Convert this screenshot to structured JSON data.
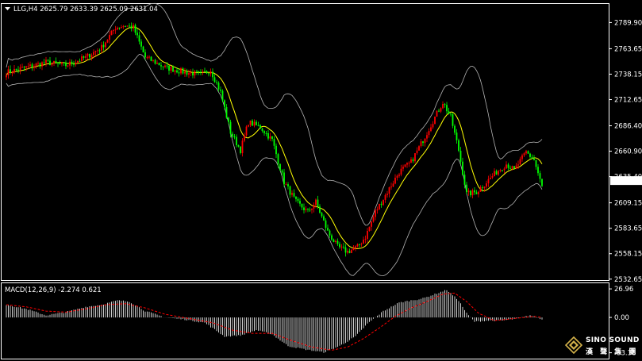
{
  "header": {
    "symbol_line": "LLG,H4  2625.79 2633.39 2625.09 2631.04",
    "macd_line": "MACD(12,26,9) -2.274 0.621"
  },
  "price_axis": {
    "ticks": [
      "2789.90",
      "2763.65",
      "2738.15",
      "2712.65",
      "2686.40",
      "2660.90",
      "2635.40",
      "2609.15",
      "2583.65",
      "2558.15",
      "2532.65"
    ],
    "current": "2631.04"
  },
  "macd_axis": {
    "ticks": [
      "26.96",
      "0.00",
      "-33.38"
    ]
  },
  "logo": {
    "line1": "SINO SOUND",
    "line2": "漢 聲 集 團"
  },
  "colors": {
    "background": "#000000",
    "bull": "#ff0000",
    "bear": "#00ff00",
    "ma": "#ffff00",
    "bands": "#b4b4b4",
    "macd_hist": "#ffffff",
    "signal": "#ff0000",
    "axis": "#ffffff"
  },
  "chart_data": [
    {
      "type": "candlestick",
      "symbol": "LLG",
      "timeframe": "H4",
      "ylim": [
        2532.65,
        2795
      ],
      "ohlc_anchor": [
        [
          0,
          2740
        ],
        [
          10,
          2745
        ],
        [
          20,
          2750
        ],
        [
          30,
          2747
        ],
        [
          40,
          2755
        ],
        [
          48,
          2765
        ],
        [
          55,
          2785
        ],
        [
          60,
          2787
        ],
        [
          64,
          2785
        ],
        [
          70,
          2755
        ],
        [
          80,
          2745
        ],
        [
          90,
          2740
        ],
        [
          98,
          2738
        ],
        [
          103,
          2742
        ],
        [
          108,
          2720
        ],
        [
          113,
          2680
        ],
        [
          118,
          2662
        ],
        [
          122,
          2690
        ],
        [
          128,
          2685
        ],
        [
          134,
          2672
        ],
        [
          140,
          2630
        ],
        [
          146,
          2610
        ],
        [
          152,
          2600
        ],
        [
          156,
          2610
        ],
        [
          162,
          2580
        ],
        [
          167,
          2565
        ],
        [
          172,
          2560
        ],
        [
          177,
          2565
        ],
        [
          181,
          2575
        ],
        [
          186,
          2600
        ],
        [
          192,
          2620
        ],
        [
          198,
          2640
        ],
        [
          204,
          2650
        ],
        [
          210,
          2672
        ],
        [
          216,
          2695
        ],
        [
          220,
          2710
        ],
        [
          224,
          2695
        ],
        [
          228,
          2662
        ],
        [
          232,
          2618
        ],
        [
          237,
          2620
        ],
        [
          241,
          2628
        ],
        [
          247,
          2640
        ],
        [
          252,
          2648
        ],
        [
          256,
          2642
        ],
        [
          262,
          2660
        ],
        [
          266,
          2652
        ],
        [
          270,
          2625
        ]
      ]
    },
    {
      "type": "macd",
      "params": "12,26,9",
      "ylim": [
        -33.38,
        26.96
      ],
      "hist_anchor": [
        [
          0,
          12
        ],
        [
          10,
          8
        ],
        [
          20,
          2
        ],
        [
          30,
          5
        ],
        [
          40,
          10
        ],
        [
          48,
          12
        ],
        [
          56,
          16
        ],
        [
          62,
          15
        ],
        [
          70,
          6
        ],
        [
          80,
          0
        ],
        [
          90,
          -2
        ],
        [
          100,
          -5
        ],
        [
          110,
          -18
        ],
        [
          118,
          -17
        ],
        [
          126,
          -12
        ],
        [
          134,
          -16
        ],
        [
          142,
          -27
        ],
        [
          150,
          -30
        ],
        [
          160,
          -33
        ],
        [
          168,
          -27
        ],
        [
          176,
          -18
        ],
        [
          182,
          -6
        ],
        [
          190,
          6
        ],
        [
          198,
          14
        ],
        [
          204,
          16
        ],
        [
          210,
          18
        ],
        [
          216,
          22
        ],
        [
          222,
          26
        ],
        [
          228,
          16
        ],
        [
          232,
          4
        ],
        [
          236,
          -4
        ],
        [
          242,
          -3
        ],
        [
          250,
          -3
        ],
        [
          258,
          -1
        ],
        [
          264,
          2
        ],
        [
          270,
          -2
        ]
      ],
      "signal_anchor": [
        [
          0,
          12
        ],
        [
          10,
          10
        ],
        [
          20,
          6
        ],
        [
          30,
          5
        ],
        [
          40,
          8
        ],
        [
          50,
          12
        ],
        [
          60,
          13
        ],
        [
          70,
          9
        ],
        [
          80,
          3
        ],
        [
          92,
          -1
        ],
        [
          104,
          -5
        ],
        [
          114,
          -12
        ],
        [
          124,
          -15
        ],
        [
          134,
          -15
        ],
        [
          144,
          -22
        ],
        [
          154,
          -28
        ],
        [
          164,
          -31
        ],
        [
          172,
          -28
        ],
        [
          180,
          -20
        ],
        [
          188,
          -10
        ],
        [
          196,
          1
        ],
        [
          204,
          9
        ],
        [
          212,
          15
        ],
        [
          220,
          22
        ],
        [
          226,
          23
        ],
        [
          232,
          15
        ],
        [
          238,
          4
        ],
        [
          246,
          -3
        ],
        [
          256,
          -1
        ],
        [
          266,
          1
        ],
        [
          270,
          0
        ]
      ]
    }
  ]
}
